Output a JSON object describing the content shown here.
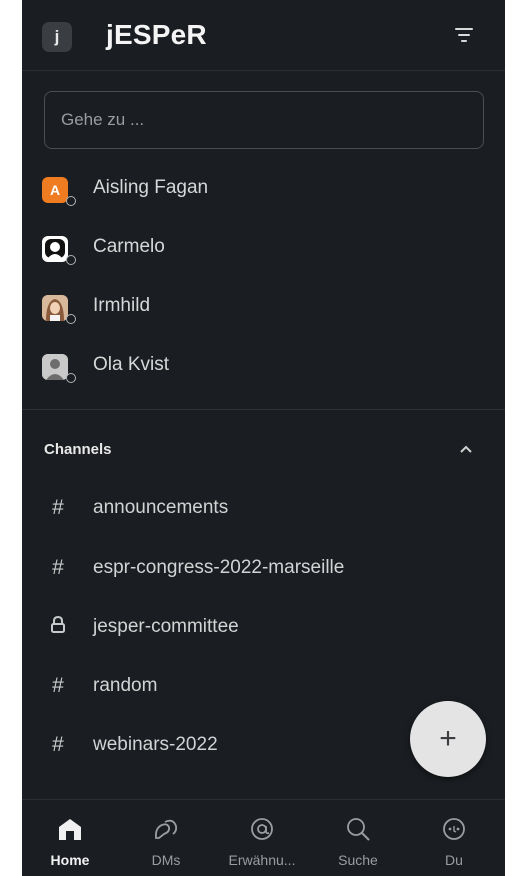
{
  "workspace": {
    "initial": "j",
    "name": "jESPeR"
  },
  "search": {
    "placeholder": "Gehe zu ..."
  },
  "dms": [
    {
      "name": "Aisling Fagan",
      "avatar_letter": "A",
      "avatar_color": "#f07c21"
    },
    {
      "name": "Carmelo",
      "avatar_color": "#ffffff"
    },
    {
      "name": "Irmhild",
      "avatar_color": "#c6926b"
    },
    {
      "name": "Ola Kvist",
      "avatar_color": "#c9c9c9"
    }
  ],
  "channels_section": {
    "title": "Channels"
  },
  "channels": [
    {
      "name": "announcements",
      "icon": "#",
      "type": "public"
    },
    {
      "name": "espr-congress-2022-marseille",
      "icon": "#",
      "type": "public"
    },
    {
      "name": "jesper-committee",
      "icon": "lock-icon",
      "type": "private"
    },
    {
      "name": "random",
      "icon": "#",
      "type": "public"
    },
    {
      "name": "webinars-2022",
      "icon": "#",
      "type": "public"
    }
  ],
  "fab": {
    "label": "+"
  },
  "nav": [
    {
      "label": "Home",
      "icon": "home-icon",
      "active": true
    },
    {
      "label": "DMs",
      "icon": "dms-icon",
      "active": false
    },
    {
      "label": "Erwähnu...",
      "icon": "mention-icon",
      "active": false
    },
    {
      "label": "Suche",
      "icon": "search-icon",
      "active": false
    },
    {
      "label": "Du",
      "icon": "profile-icon",
      "active": false
    }
  ]
}
